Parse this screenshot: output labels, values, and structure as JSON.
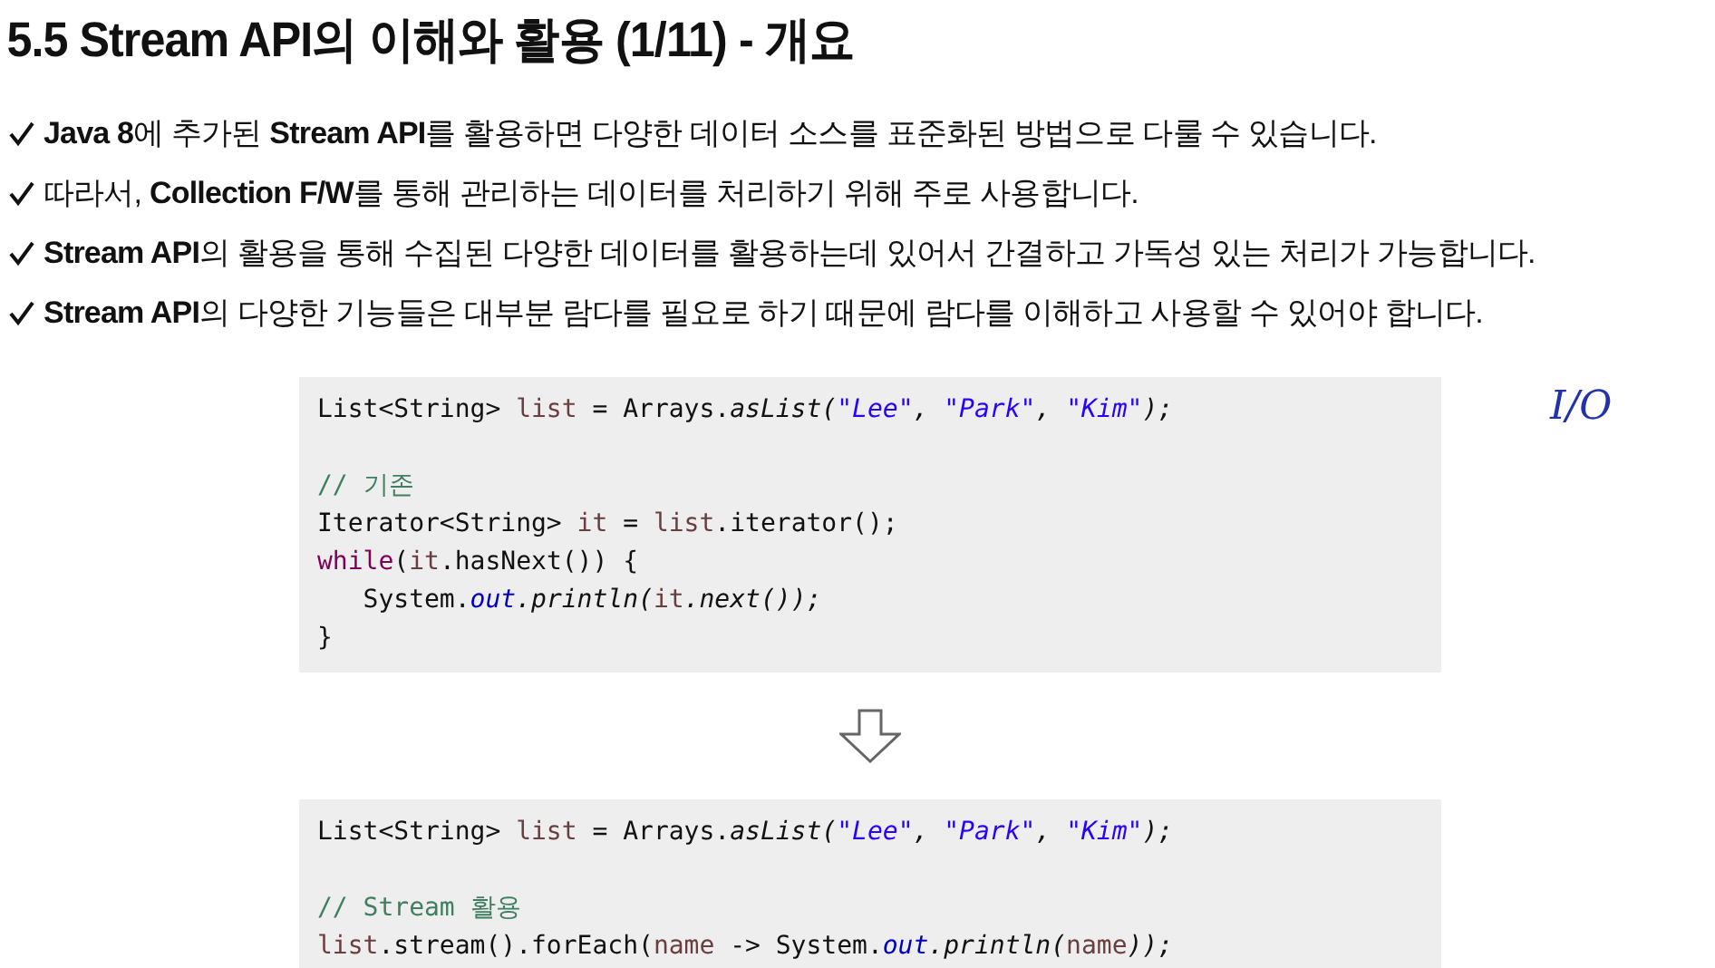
{
  "title": "5.5 Stream API의 이해와 활용 (1/11) - 개요",
  "bullets": [
    "**Java 8**에 추가된 **Stream API**를 활용하면 다양한 데이터 소스를 표준화된 방법으로 다룰 수 있습니다.",
    "따라서, **Collection F/W**를 통해 관리하는 데이터를 처리하기 위해 주로 사용합니다.",
    "**Stream API**의 활용을 통해 수집된 다양한 데이터를 활용하는데 있어서 간결하고 가독성 있는 처리가 가능합니다.",
    "**Stream API**의 다양한 기능들은 대부분 람다를 필요로 하기 때문에 람다를 이해하고 사용할 수 있어야 합니다."
  ],
  "handwritten_note": "I/O",
  "code_blocks": [
    {
      "lines": [
        {
          "kind": "code",
          "tokens": [
            {
              "kind": "plain",
              "text": "List<String> "
            },
            {
              "kind": "var",
              "text": "list"
            },
            {
              "kind": "plain",
              "text": " = Arrays."
            },
            {
              "kind": "method",
              "text": "asList("
            },
            {
              "kind": "string",
              "text": "\"Lee\""
            },
            {
              "kind": "method",
              "text": ", "
            },
            {
              "kind": "string",
              "text": "\"Park\""
            },
            {
              "kind": "method",
              "text": ", "
            },
            {
              "kind": "string",
              "text": "\"Kim\""
            },
            {
              "kind": "method",
              "text": ");"
            }
          ]
        },
        {
          "kind": "blank"
        },
        {
          "kind": "code",
          "tokens": [
            {
              "kind": "comment",
              "text": "// 기존"
            }
          ]
        },
        {
          "kind": "code",
          "tokens": [
            {
              "kind": "plain",
              "text": "Iterator<String> "
            },
            {
              "kind": "var",
              "text": "it"
            },
            {
              "kind": "plain",
              "text": " = "
            },
            {
              "kind": "var",
              "text": "list"
            },
            {
              "kind": "plain",
              "text": ".iterator();"
            }
          ]
        },
        {
          "kind": "code",
          "tokens": [
            {
              "kind": "keyword",
              "text": "while"
            },
            {
              "kind": "plain",
              "text": "("
            },
            {
              "kind": "var",
              "text": "it"
            },
            {
              "kind": "plain",
              "text": ".hasNext()) {"
            }
          ]
        },
        {
          "kind": "code",
          "tokens": [
            {
              "kind": "plain",
              "text": "   System."
            },
            {
              "kind": "field",
              "text": "out"
            },
            {
              "kind": "method",
              "text": ".println("
            },
            {
              "kind": "var",
              "text": "it"
            },
            {
              "kind": "method",
              "text": ".next());"
            }
          ]
        },
        {
          "kind": "code",
          "tokens": [
            {
              "kind": "plain",
              "text": "}"
            }
          ]
        }
      ]
    },
    {
      "lines": [
        {
          "kind": "code",
          "tokens": [
            {
              "kind": "plain",
              "text": "List<String> "
            },
            {
              "kind": "var",
              "text": "list"
            },
            {
              "kind": "plain",
              "text": " = Arrays."
            },
            {
              "kind": "method",
              "text": "asList("
            },
            {
              "kind": "string",
              "text": "\"Lee\""
            },
            {
              "kind": "method",
              "text": ", "
            },
            {
              "kind": "string",
              "text": "\"Park\""
            },
            {
              "kind": "method",
              "text": ", "
            },
            {
              "kind": "string",
              "text": "\"Kim\""
            },
            {
              "kind": "method",
              "text": ");"
            }
          ]
        },
        {
          "kind": "blank"
        },
        {
          "kind": "code",
          "tokens": [
            {
              "kind": "comment",
              "text": "// Stream 활용"
            }
          ]
        },
        {
          "kind": "code",
          "tokens": [
            {
              "kind": "var",
              "text": "list"
            },
            {
              "kind": "plain",
              "text": ".stream().forEach("
            },
            {
              "kind": "var",
              "text": "name"
            },
            {
              "kind": "plain",
              "text": " -> System."
            },
            {
              "kind": "field",
              "text": "out"
            },
            {
              "kind": "method",
              "text": ".println("
            },
            {
              "kind": "var",
              "text": "name"
            },
            {
              "kind": "method",
              "text": "));"
            }
          ]
        }
      ]
    }
  ]
}
